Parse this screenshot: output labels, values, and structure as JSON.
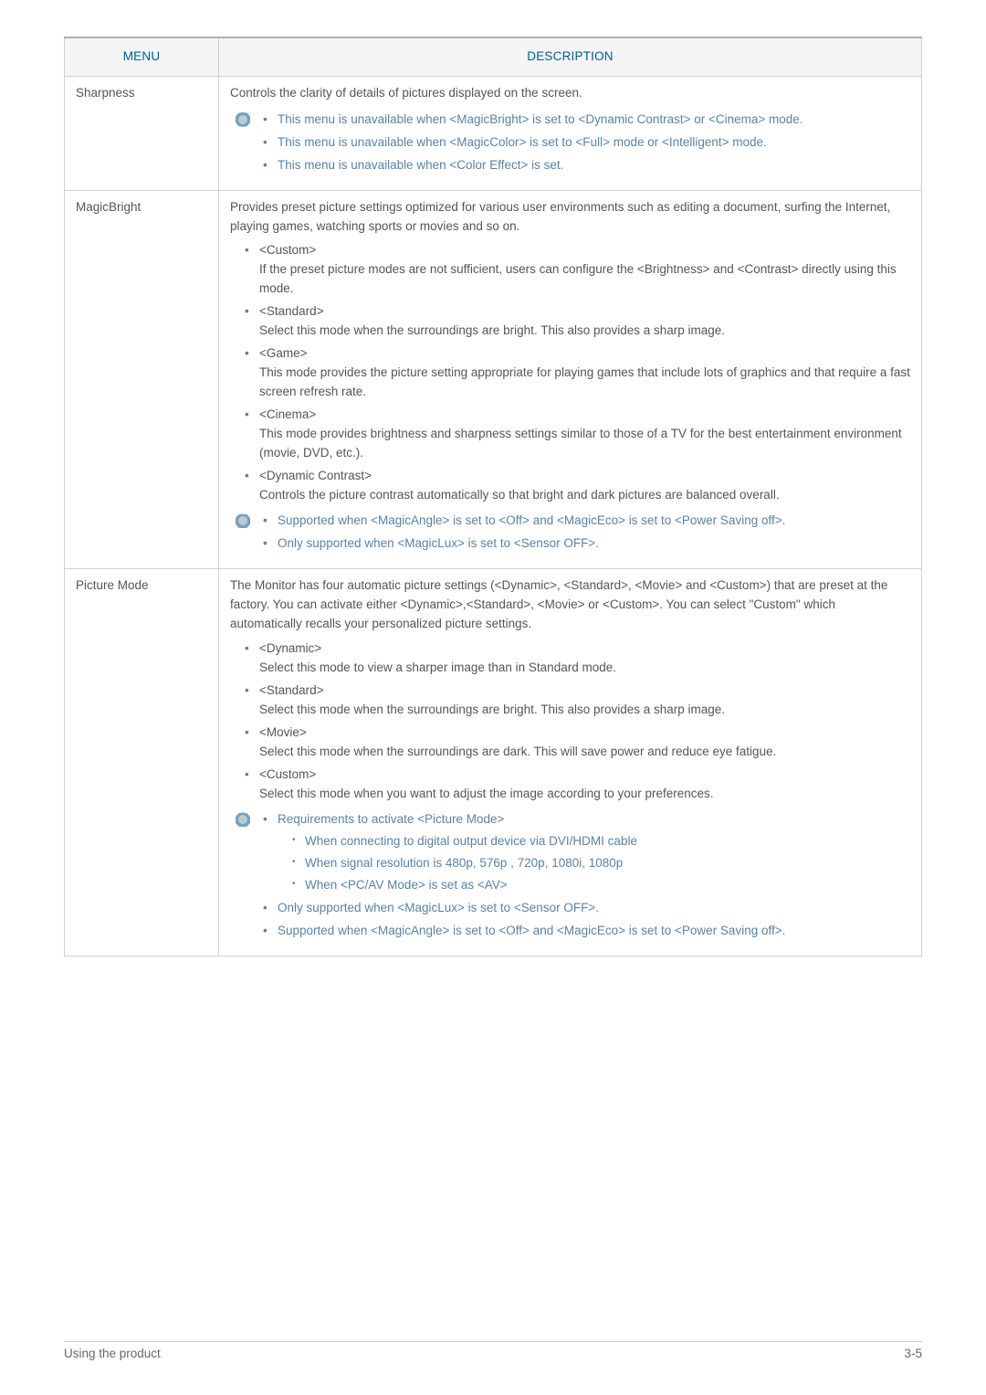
{
  "table": {
    "headers": {
      "menu": "Menu",
      "description": "Description"
    },
    "rows": [
      {
        "menu": "Sharpness",
        "lead": "Controls the clarity of details of pictures displayed on the screen.",
        "notes": [
          "This menu is unavailable when <MagicBright> is set to <Dynamic Contrast> or <Cinema> mode.",
          "This menu is unavailable when <MagicColor> is set to <Full> mode or <Intelligent> mode.",
          "This menu is unavailable when <Color Effect> is set."
        ]
      },
      {
        "menu": "MagicBright",
        "lead": "Provides preset picture settings optimized for various user environments such as editing a document, surfing the Internet, playing games, watching sports or movies and so on.",
        "items": [
          {
            "title": "<Custom>",
            "text": "If the preset picture modes are not sufficient, users can configure the <Brightness> and <Contrast> directly using this mode."
          },
          {
            "title": "<Standard>",
            "text": "Select this mode when the surroundings are bright. This also provides a sharp image."
          },
          {
            "title": "<Game>",
            "text": "This mode provides the picture setting appropriate for playing games that include lots of graphics and that require a fast screen refresh rate."
          },
          {
            "title": "<Cinema>",
            "text": "This mode provides brightness and sharpness settings similar to those of a TV for the best entertainment environment (movie, DVD, etc.)."
          },
          {
            "title": "<Dynamic Contrast>",
            "text": "Controls the picture contrast automatically so that bright and dark pictures are balanced overall."
          }
        ],
        "notes": [
          "Supported when <MagicAngle> is set to <Off> and <MagicEco> is set to <Power Saving off>.",
          "Only supported when <MagicLux> is set to <Sensor OFF>."
        ]
      },
      {
        "menu": "Picture Mode",
        "lead": "The Monitor has four automatic picture settings (<Dynamic>, <Standard>, <Movie> and <Custom>) that are preset at the factory. You can activate either <Dynamic>,<Standard>, <Movie> or <Custom>. You can select \"Custom\" which automatically recalls your personalized picture settings.",
        "items": [
          {
            "title": "<Dynamic>",
            "text": "Select this mode to view a sharper image than in Standard mode."
          },
          {
            "title": "<Standard>",
            "text": "Select this mode when the surroundings are bright. This also provides a sharp image."
          },
          {
            "title": "<Movie>",
            "text": "Select this mode when the surroundings are dark. This will save power and reduce eye fatigue."
          },
          {
            "title": "<Custom>",
            "text": "Select this mode when you want to adjust the image according to your preferences."
          }
        ],
        "notes2": {
          "lead": "Requirements to activate <Picture Mode>",
          "sub": [
            "When connecting to digital output device via DVI/HDMI cable",
            "When signal resolution is 480p, 576p , 720p, 1080i, 1080p",
            "When <PC/AV Mode> is set as <AV>"
          ],
          "rest": [
            "Only supported when <MagicLux> is set to <Sensor OFF>.",
            "Supported when <MagicAngle> is set to <Off> and <MagicEco> is set to <Power Saving off>."
          ]
        }
      }
    ]
  },
  "footer": {
    "left": "Using the product",
    "right": "3-5"
  }
}
